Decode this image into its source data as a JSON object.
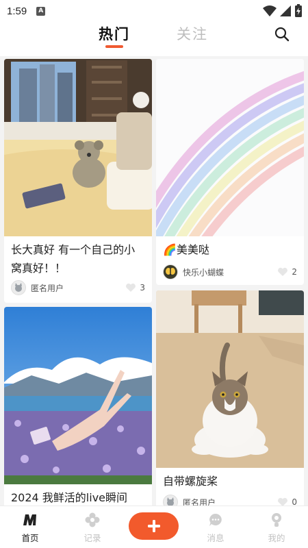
{
  "status_bar": {
    "time": "1:59",
    "badge": "A"
  },
  "header": {
    "tabs": [
      {
        "label": "热门",
        "active": true
      },
      {
        "label": "关注",
        "active": false
      }
    ],
    "accent": "#f05a31"
  },
  "feed": {
    "cards": [
      {
        "title": "长大真好 有一个自己的小窝真好！！",
        "author": "匿名用户",
        "likes": "3",
        "image": "cozy-bedroom-teddy-bear"
      },
      {
        "title": "🌈美美哒",
        "author": "快乐小蝴蝶",
        "likes": "2",
        "image": "pastel-rainbow"
      },
      {
        "title": "2024 我鲜活的live瞬间",
        "author": "",
        "likes": "",
        "image": "lake-mountains-flowers"
      },
      {
        "title": "自带螺旋桨",
        "author": "匿名用户",
        "likes": "0",
        "image": "cat-on-floor"
      }
    ]
  },
  "bottom_nav": {
    "items": [
      {
        "label": "首页",
        "icon": "m-logo-icon",
        "active": true
      },
      {
        "label": "记录",
        "icon": "flower-icon",
        "active": false
      },
      {
        "label": "消息",
        "icon": "chat-bubble-icon",
        "active": false
      },
      {
        "label": "我的",
        "icon": "profile-icon",
        "active": false
      }
    ],
    "add_icon": "plus-icon",
    "add_color": "#f25a2c"
  }
}
